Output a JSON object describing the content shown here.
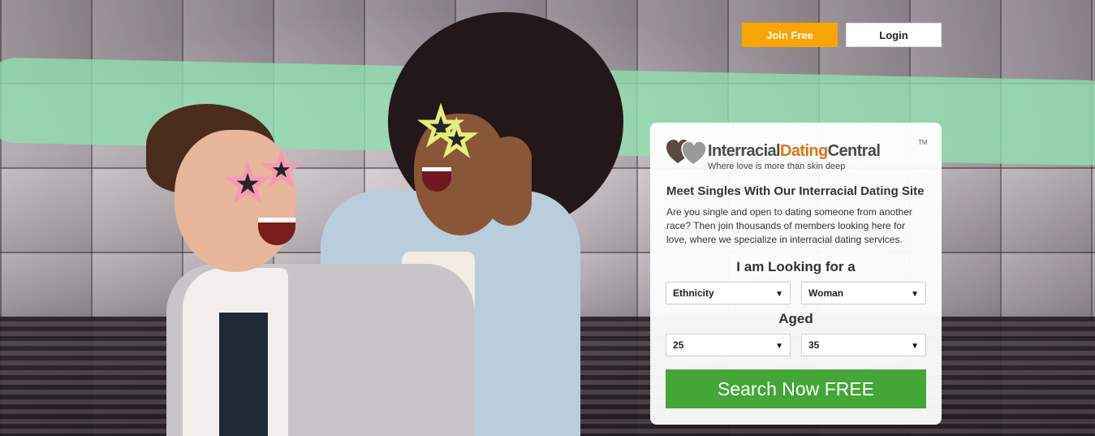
{
  "header": {
    "join_label": "Join Free",
    "login_label": "Login"
  },
  "brand": {
    "name_part1": "Interracial",
    "name_part2": "Dating",
    "name_part3": "Central",
    "trademark": "TM",
    "tagline": "Where love is more than skin deep"
  },
  "panel": {
    "heading": "Meet Singles With Our Interracial Dating Site",
    "description": "Are you single and open to dating someone from another race? Then join thousands of members looking here for love, where we specialize in interracial dating services.",
    "looking_label": "I am Looking for a",
    "aged_label": "Aged",
    "ethnicity_value": "Ethnicity",
    "gender_value": "Woman",
    "age_min_value": "25",
    "age_max_value": "35",
    "search_label": "Search Now FREE"
  },
  "colors": {
    "join_button": "#f7a600",
    "search_button": "#44a637",
    "brand_accent": "#e0721c",
    "stripe": "#8fe0b0"
  },
  "icons": {
    "dropdown_arrow": "▼",
    "logo_hearts": "hearts-icon"
  }
}
